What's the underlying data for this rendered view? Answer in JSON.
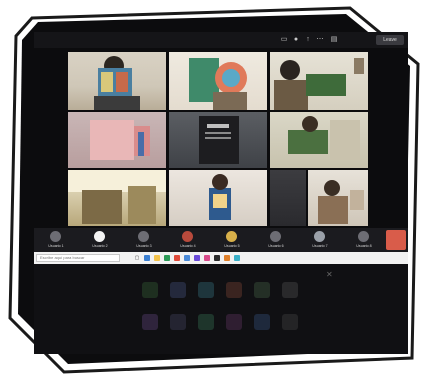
{
  "meeting": {
    "leave_label": "Leave",
    "search_placeholder": "Escribe aquí para buscar",
    "participants": [
      {
        "name": "Usuario 1"
      },
      {
        "name": "Usuario 2"
      },
      {
        "name": "Usuario 3"
      },
      {
        "name": "Usuario 4"
      },
      {
        "name": "Usuario 5"
      },
      {
        "name": "Usuario 6"
      },
      {
        "name": "Usuario 7"
      },
      {
        "name": "Usuario 8"
      }
    ],
    "tile_labels": [
      "",
      "",
      "",
      "",
      "",
      "",
      "",
      "",
      "",
      ""
    ],
    "clock_time": "",
    "clock_date": ""
  },
  "colors": {
    "frame_border": "#1a1a1a",
    "screen_bg": "#0c0c0e",
    "taskbar_bg": "#f2f2f2"
  },
  "icons": [
    "camera-icon",
    "mic-icon",
    "share-icon",
    "more-icon",
    "chat-icon",
    "people-icon"
  ]
}
